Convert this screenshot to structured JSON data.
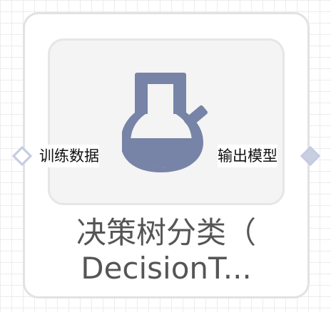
{
  "node": {
    "icon": "flask-icon",
    "title_line1": "决策树分类（",
    "title_line2": "DecisionT...",
    "input_port": {
      "label": "训练数据"
    },
    "output_port": {
      "label": "输出模型"
    }
  },
  "colors": {
    "icon": "#7784a8",
    "port_border": "#c4cbe1",
    "title": "#555555"
  }
}
